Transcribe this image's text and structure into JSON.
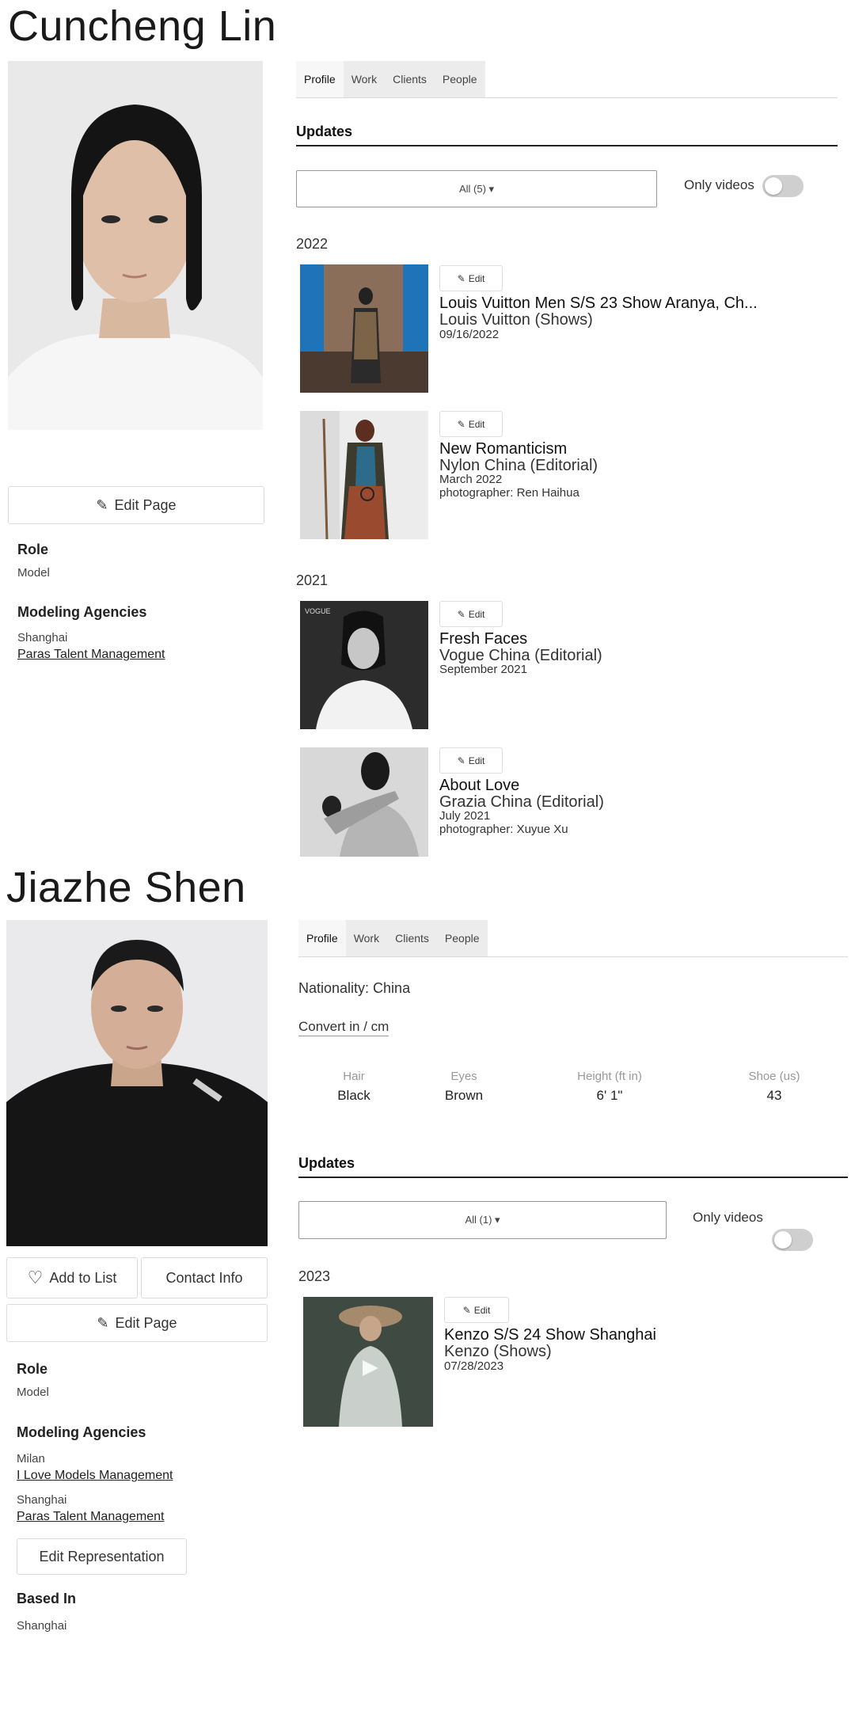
{
  "profile1": {
    "name": "Cuncheng Lin",
    "tabs": [
      "Profile",
      "Work",
      "Clients",
      "People"
    ],
    "edit_page_label": "Edit Page",
    "role_label": "Role",
    "role_value": "Model",
    "agencies_label": "Modeling Agencies",
    "agencies": [
      {
        "city": "Shanghai",
        "name": "Paras Talent Management"
      }
    ],
    "updates_label": "Updates",
    "filter_label": "All (5) ▾",
    "only_videos_label": "Only videos",
    "edit_label": "Edit",
    "groups": [
      {
        "year": "2022",
        "items": [
          {
            "title": "Louis Vuitton Men S/S 23 Show Aranya, Ch...",
            "subtitle": "Louis Vuitton (Shows)",
            "date": "09/16/2022",
            "photographer": ""
          },
          {
            "title": "New Romanticism",
            "subtitle": "Nylon China (Editorial)",
            "date": "March 2022",
            "photographer": "photographer: Ren Haihua"
          }
        ]
      },
      {
        "year": "2021",
        "items": [
          {
            "title": "Fresh Faces",
            "subtitle": "Vogue China (Editorial)",
            "date": "September 2021",
            "photographer": ""
          },
          {
            "title": "About Love",
            "subtitle": "Grazia China (Editorial)",
            "date": "July 2021",
            "photographer": "photographer: Xuyue Xu"
          }
        ]
      }
    ]
  },
  "profile2": {
    "name": "Jiazhe Shen",
    "tabs": [
      "Profile",
      "Work",
      "Clients",
      "People"
    ],
    "nationality": "Nationality: China",
    "convert_label": "Convert in / cm",
    "stats": [
      {
        "label": "Hair",
        "value": "Black"
      },
      {
        "label": "Eyes",
        "value": "Brown"
      },
      {
        "label": "Height (ft in)",
        "value": "6' 1\""
      },
      {
        "label": "Shoe (us)",
        "value": "43"
      }
    ],
    "updates_label": "Updates",
    "filter_label": "All (1) ▾",
    "only_videos_label": "Only videos",
    "year": "2023",
    "edit_label": "Edit",
    "update": {
      "title": "Kenzo S/S 24 Show Shanghai",
      "subtitle": "Kenzo (Shows)",
      "date": "07/28/2023"
    },
    "add_to_list_label": "Add to List",
    "contact_info_label": "Contact Info",
    "edit_page_label": "Edit Page",
    "role_label": "Role",
    "role_value": "Model",
    "agencies_label": "Modeling Agencies",
    "agencies": [
      {
        "city": "Milan",
        "name": "I Love Models Management"
      },
      {
        "city": "Shanghai",
        "name": "Paras Talent Management"
      }
    ],
    "edit_representation_label": "Edit Representation",
    "based_in_label": "Based In",
    "based_in_value": "Shanghai"
  },
  "colors": {
    "text": "#222222",
    "tab_bg": "#ececec",
    "border": "#dcdcdc",
    "toggle_off": "#cfcfcf"
  }
}
